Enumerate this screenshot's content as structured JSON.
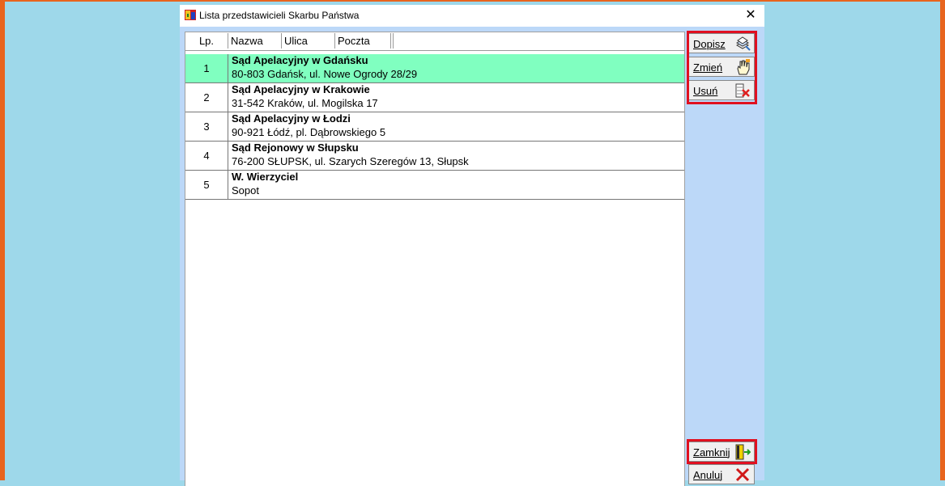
{
  "window": {
    "title": "Lista przedstawicieli Skarbu Państwa",
    "close_glyph": "✕"
  },
  "table": {
    "columns": [
      "Lp.",
      "Nazwa",
      "Ulica",
      "Poczta"
    ],
    "rows": [
      {
        "lp": "1",
        "name": "Sąd Apelacyjny w Gdańsku",
        "address": "80-803 Gdańsk, ul. Nowe Ogrody 28/29",
        "selected": true
      },
      {
        "lp": "2",
        "name": "Sąd Apelacyjny w Krakowie",
        "address": "31-542 Kraków, ul. Mogilska 17",
        "selected": false
      },
      {
        "lp": "3",
        "name": "Sąd Apelacyjny w Łodzi",
        "address": "90-921 Łódź, pl. Dąbrowskiego 5",
        "selected": false
      },
      {
        "lp": "4",
        "name": "Sąd Rejonowy w Słupsku",
        "address": "76-200 SŁUPSK, ul. Szarych Szeregów 13, Słupsk",
        "selected": false
      },
      {
        "lp": "5",
        "name": "W. Wierzyciel",
        "address": "Sopot",
        "selected": false
      }
    ]
  },
  "buttons": {
    "add": {
      "label": "Dopisz",
      "icon": "add-record-icon"
    },
    "edit": {
      "label": "Zmień",
      "icon": "hand-edit-icon"
    },
    "delete": {
      "label": "Usuń",
      "icon": "delete-record-icon"
    },
    "close": {
      "label": "Zamknij",
      "icon": "exit-door-icon"
    },
    "cancel": {
      "label": "Anuluj",
      "icon": "cancel-x-icon"
    }
  },
  "colors": {
    "selected_row": "#80ffc0",
    "highlight": "#e01020",
    "background": "#9ed8ea",
    "client": "#bcd8f8"
  }
}
